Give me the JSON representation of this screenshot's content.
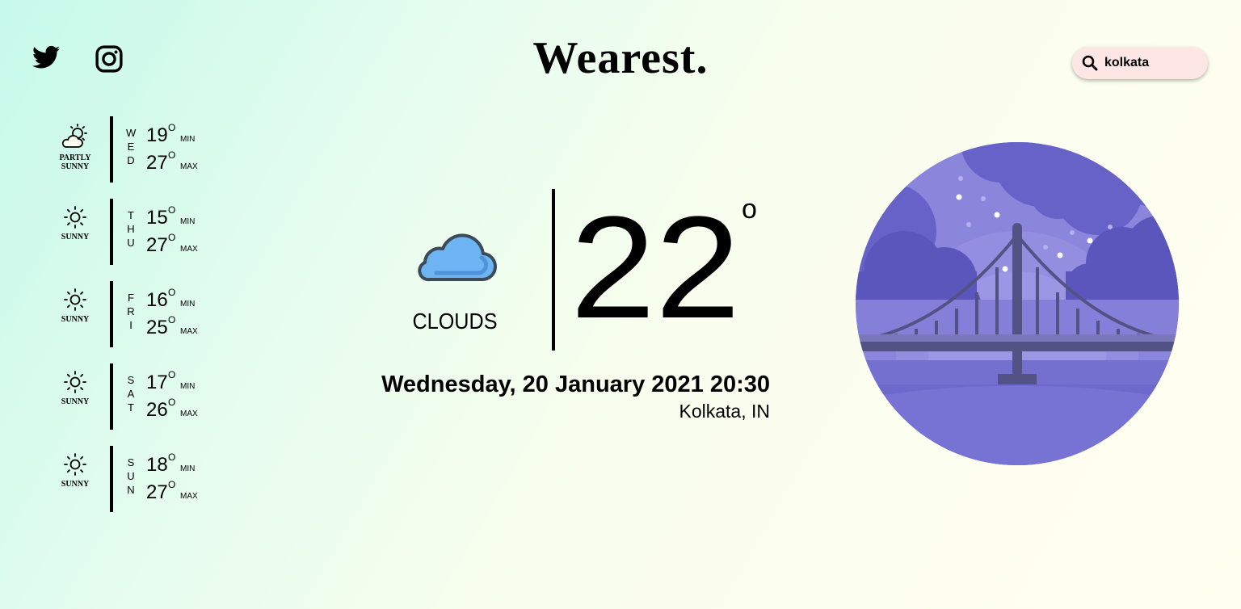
{
  "header": {
    "brand": "Wearest.",
    "social": [
      {
        "icon": "twitter-icon"
      },
      {
        "icon": "instagram-icon"
      }
    ],
    "search": {
      "icon": "search-icon",
      "value": "kolkata"
    }
  },
  "forecast": [
    {
      "icon": "partly-sunny-icon",
      "condition": "PARTLY SUNNY",
      "day": [
        "W",
        "E",
        "D"
      ],
      "min": "19",
      "max": "27"
    },
    {
      "icon": "sun-icon",
      "condition": "SUNNY",
      "day": [
        "T",
        "H",
        "U"
      ],
      "min": "15",
      "max": "27"
    },
    {
      "icon": "sun-icon",
      "condition": "SUNNY",
      "day": [
        "F",
        "R",
        "I"
      ],
      "min": "16",
      "max": "25"
    },
    {
      "icon": "sun-icon",
      "condition": "SUNNY",
      "day": [
        "S",
        "A",
        "T"
      ],
      "min": "17",
      "max": "26"
    },
    {
      "icon": "sun-icon",
      "condition": "SUNNY",
      "day": [
        "S",
        "U",
        "N"
      ],
      "min": "18",
      "max": "27"
    }
  ],
  "labels": {
    "degree": "O",
    "min": "MIN",
    "max": "MAX"
  },
  "current": {
    "icon": "cloud-icon",
    "condition": "CLOUDS",
    "temperature": "22",
    "degree": "o",
    "datetime": "Wednesday, 20 January 2021 20:30",
    "location": "Kolkata, IN"
  },
  "illustration": {
    "icon": "night-bridge-illustration"
  },
  "colors": {
    "search_bg": "#fde6e4",
    "cloud": "#6cb4f2",
    "scene_sky": "#8c87de",
    "scene_cloud": "#6460c6",
    "bridge": "#535284"
  }
}
